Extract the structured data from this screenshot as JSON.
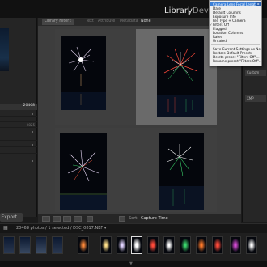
{
  "top_bar": {
    "module_library": "Library",
    "module_separator": "|",
    "module_develop": "Devel"
  },
  "filter_bar": {
    "title": "Library Filter :",
    "tabs": [
      "Text",
      "Attribute",
      "Metadata",
      "None"
    ]
  },
  "left_panel": {
    "photo_count": "20468",
    "rows": [
      "",
      "",
      "0825",
      "",
      "",
      "",
      "",
      ""
    ],
    "export_label": "Export..."
  },
  "toolbar": {
    "sort_label": "Sort:",
    "sort_value": "Capture Time"
  },
  "right_panel": {
    "quick_develop_label": "Custom",
    "sync_label": "XMP"
  },
  "menu": {
    "items": [
      "Camera Lens Focal Length",
      "Date",
      "Default Columns",
      "Exposure Info",
      "File Type + Camera",
      "Filters Off",
      "Flagged",
      "Location Columns",
      "Rated",
      "Unrated",
      "Save Current Settings as New Preset...",
      "Restore Default Presets",
      "Delete preset \"Filters Off\"...",
      "Rename preset \"Filters Off\"..."
    ],
    "checked_index": 5,
    "highlight_index": 0
  },
  "status_bar": {
    "text": "20468 photos / 1 selected / DSC_0817.NEF ▾"
  },
  "colors": {
    "menu_highlight": "#3b7fd6",
    "panel": "#262626",
    "grid_bg": "#3d3d3d"
  }
}
